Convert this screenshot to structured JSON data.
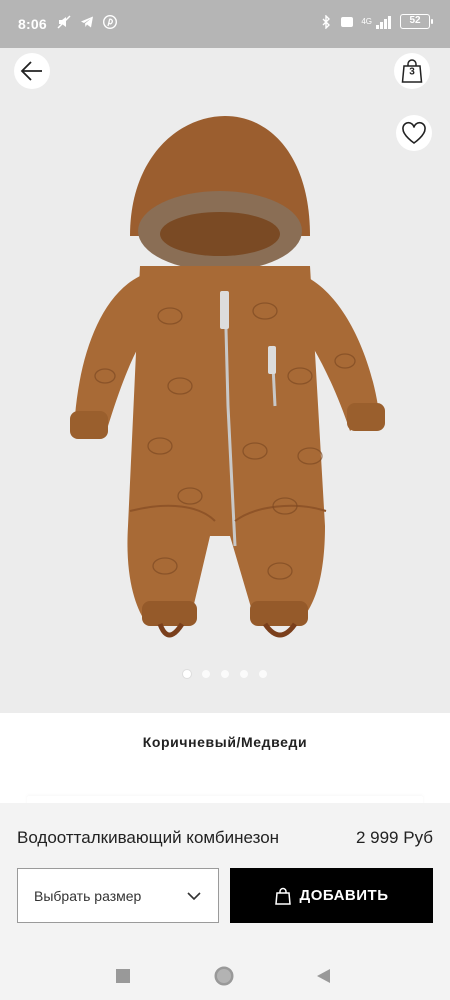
{
  "status_bar": {
    "time": "8:06",
    "network": "4G",
    "battery": "52"
  },
  "gallery": {
    "bag_count": "3",
    "image_count": 5,
    "active_image": 1,
    "icons": [
      "back-arrow-icon",
      "shopping-bag-icon",
      "heart-icon"
    ]
  },
  "product": {
    "color_name": "Коричневый/Медведи",
    "name": "Водоотталкивающий комбинезон",
    "price": "2 999 Руб"
  },
  "actions": {
    "size_placeholder": "Выбрать размер",
    "add_label": "ДОБАВИТЬ"
  },
  "colors": {
    "brand_black": "#000000",
    "garment": "#a86a36",
    "gallery_bg": "#ececec",
    "sheet_bg": "#f3f3f3"
  }
}
